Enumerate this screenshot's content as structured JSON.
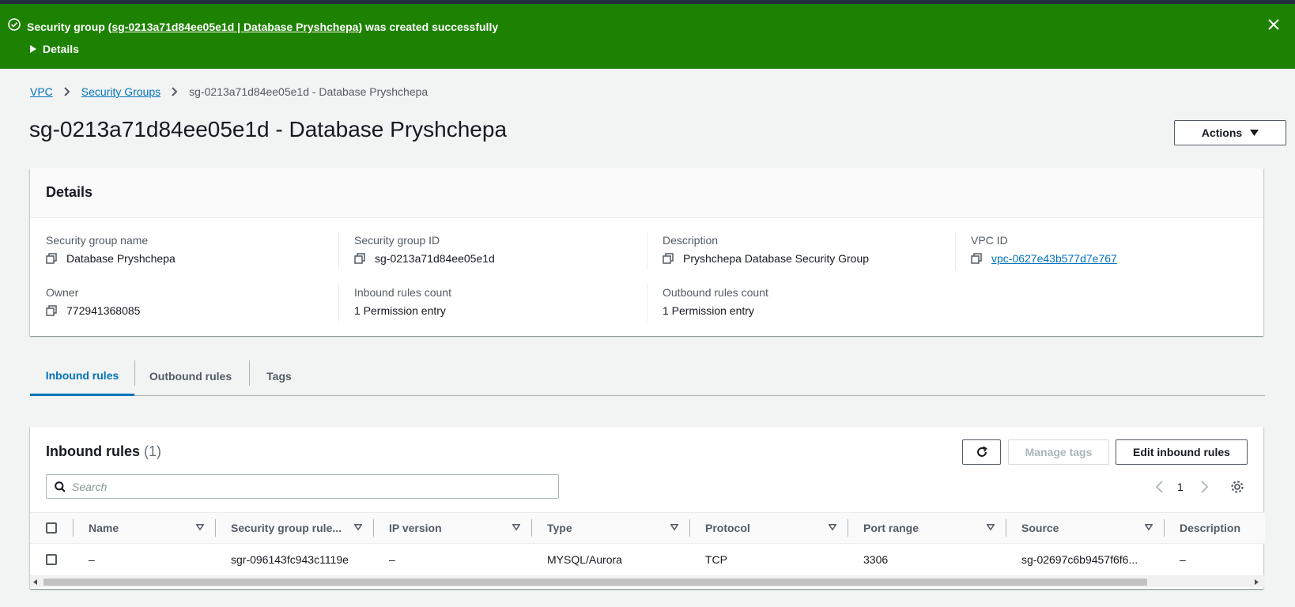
{
  "flash": {
    "message_prefix": "Security group (",
    "message_link": "sg-0213a71d84ee05e1d | Database Pryshchepa",
    "message_suffix": ") was created successfully",
    "details_label": "Details",
    "background_color": "#1d8102"
  },
  "breadcrumb": {
    "items": [
      "VPC",
      "Security Groups"
    ],
    "current": "sg-0213a71d84ee05e1d - Database Pryshchepa"
  },
  "page": {
    "title": "sg-0213a71d84ee05e1d - Database Pryshchepa",
    "actions_label": "Actions"
  },
  "details": {
    "title": "Details",
    "fields": [
      {
        "label": "Security group name",
        "value": "Database Pryshchepa",
        "copy": true
      },
      {
        "label": "Security group ID",
        "value": "sg-0213a71d84ee05e1d",
        "copy": true
      },
      {
        "label": "Description",
        "value": "Pryshchepa Database Security Group",
        "copy": true
      },
      {
        "label": "VPC ID",
        "value": "vpc-0627e43b577d7e767",
        "copy": true,
        "link": true
      },
      {
        "label": "Owner",
        "value": "772941368085",
        "copy": true
      },
      {
        "label": "Inbound rules count",
        "value": "1 Permission entry"
      },
      {
        "label": "Outbound rules count",
        "value": "1 Permission entry"
      }
    ]
  },
  "tabs": [
    {
      "label": "Inbound rules",
      "active": true
    },
    {
      "label": "Outbound rules",
      "active": false
    },
    {
      "label": "Tags",
      "active": false
    }
  ],
  "inbound": {
    "title": "Inbound rules",
    "count": "(1)",
    "manage_tags_label": "Manage tags",
    "edit_label": "Edit inbound rules",
    "search_placeholder": "Search",
    "page_number": "1",
    "columns": [
      "Name",
      "Security group rule...",
      "IP version",
      "Type",
      "Protocol",
      "Port range",
      "Source",
      "Description"
    ],
    "rows": [
      [
        "–",
        "sgr-096143fc943c1119e",
        "–",
        "MYSQL/Aurora",
        "TCP",
        "3306",
        "sg-02697c6b9457f6f6...",
        "–"
      ]
    ]
  },
  "colors": {
    "link": "#0073bb",
    "success": "#1d8102",
    "header_bar": "#232f3e"
  }
}
